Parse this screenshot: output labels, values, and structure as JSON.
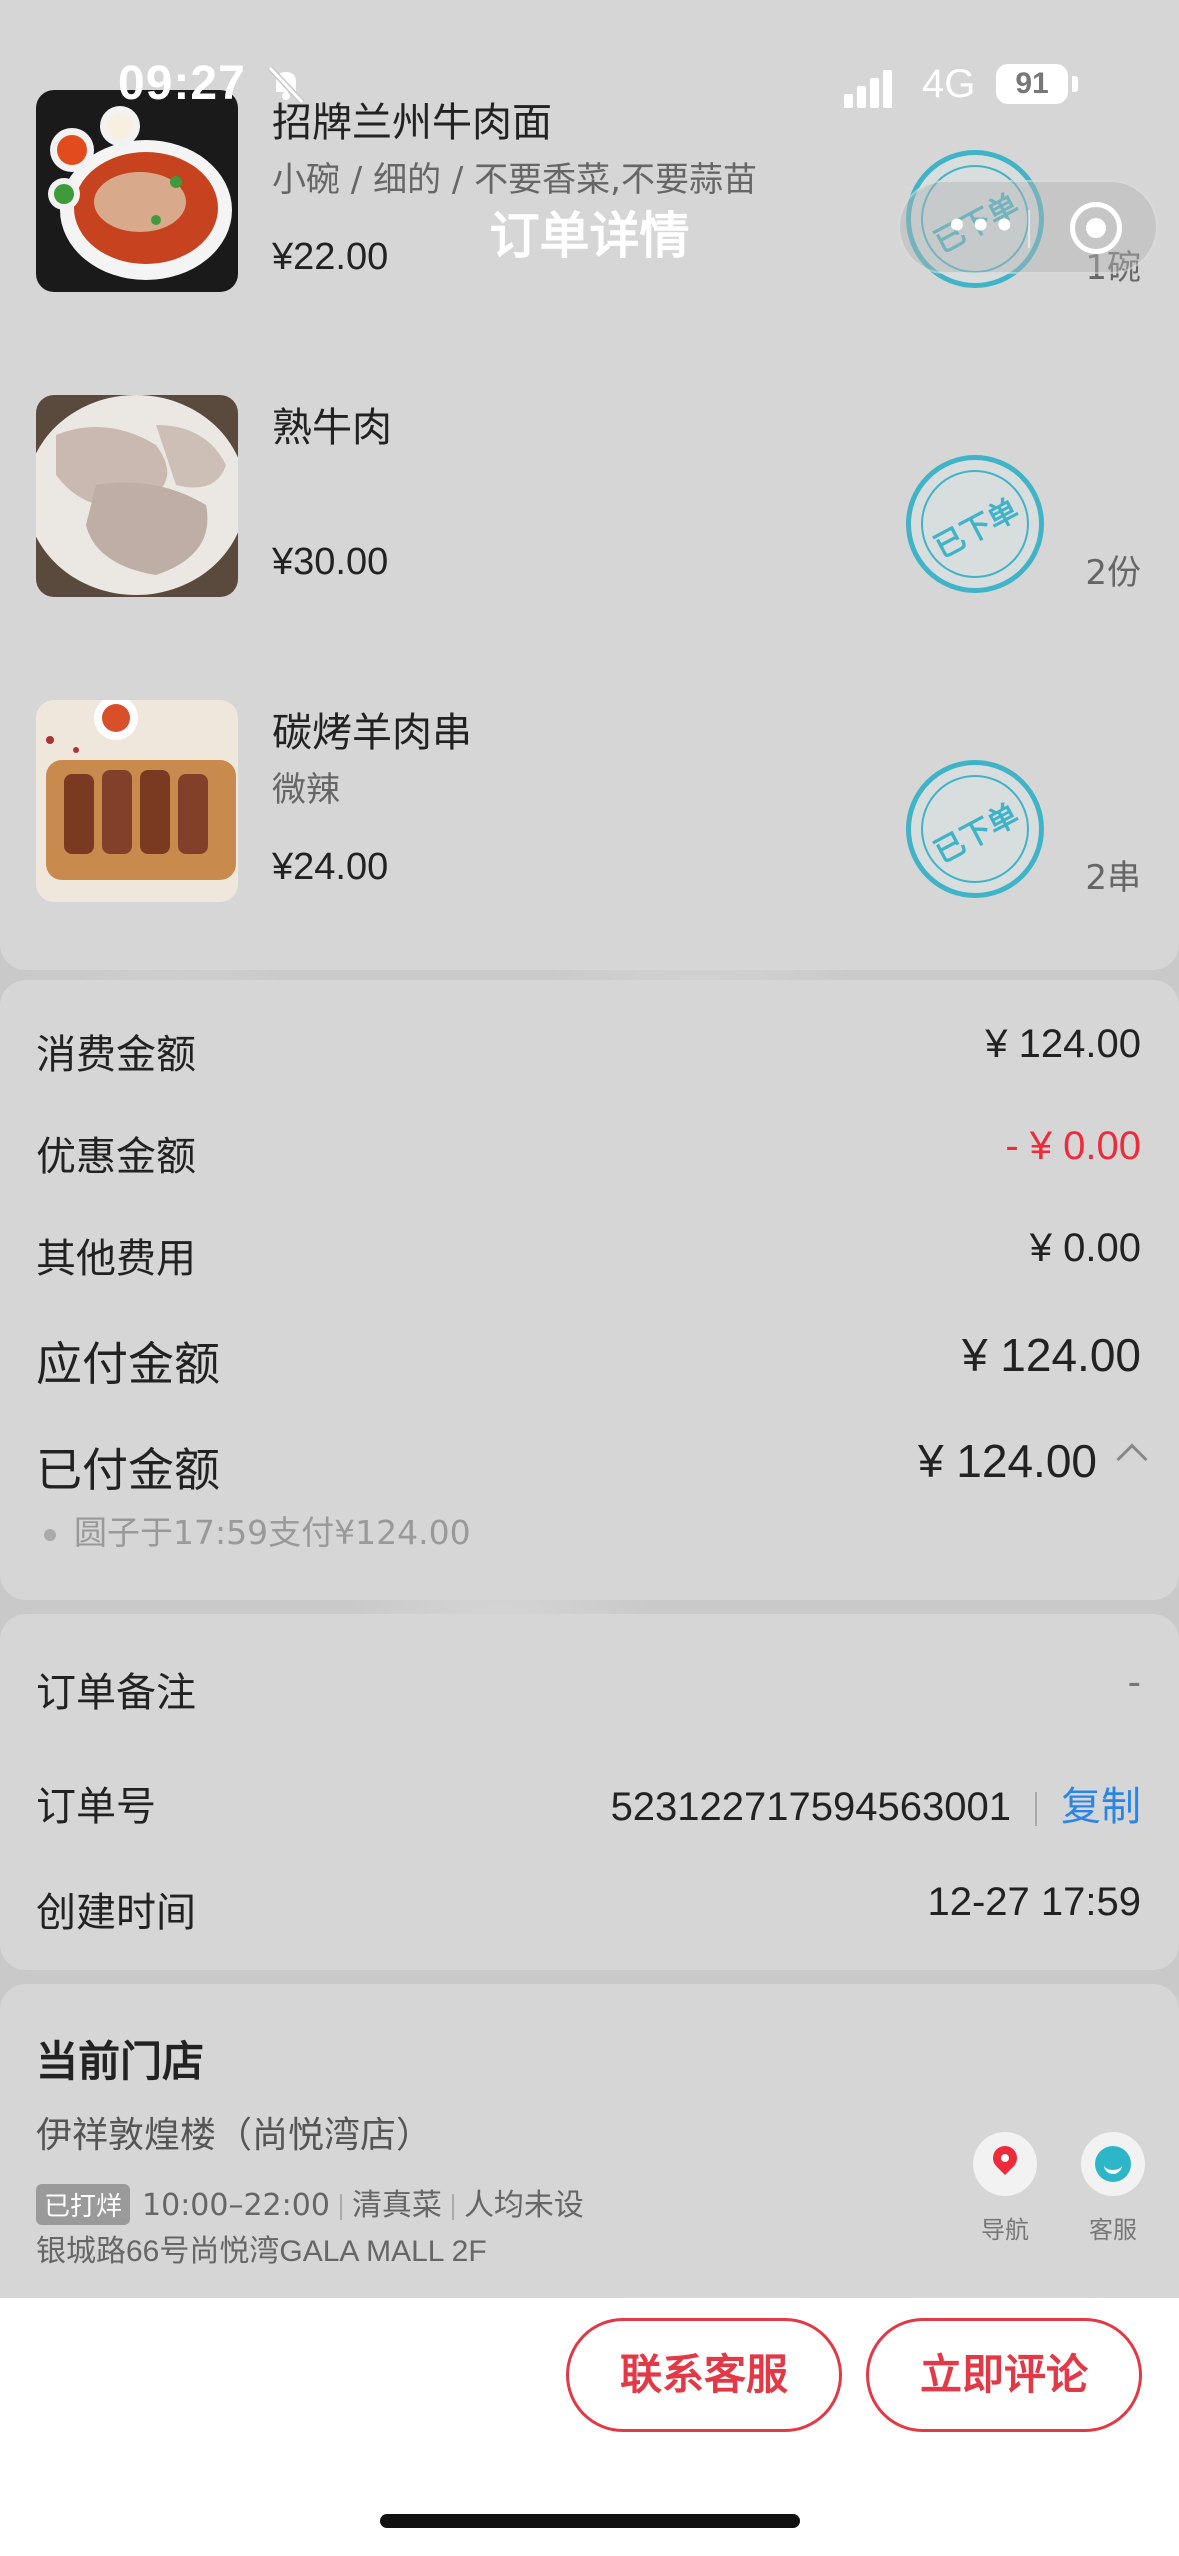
{
  "status_bar": {
    "time": "09:27",
    "network": "4G",
    "battery": "91"
  },
  "nav": {
    "title": "订单详情"
  },
  "items": [
    {
      "name": "招牌兰州牛肉面",
      "spec": "小碗 / 细的 / 不要香菜,不要蒜苗",
      "price": "¥22.00",
      "qty": "1碗",
      "stamp": "已下单"
    },
    {
      "name": "熟牛肉",
      "spec": "",
      "price": "¥30.00",
      "qty": "2份",
      "stamp": "已下单"
    },
    {
      "name": "碳烤羊肉串",
      "spec": "微辣",
      "price": "¥24.00",
      "qty": "2串",
      "stamp": "已下单"
    }
  ],
  "amounts": {
    "consume_label": "消费金额",
    "consume_value": "¥ 124.00",
    "discount_label": "优惠金额",
    "discount_value": "- ¥ 0.00",
    "other_label": "其他费用",
    "other_value": "¥ 0.00",
    "payable_label": "应付金额",
    "payable_value": "¥ 124.00",
    "paid_label": "已付金额",
    "paid_value": "¥ 124.00",
    "pay_note": "圆子于17:59支付¥124.00"
  },
  "order_info": {
    "remark_label": "订单备注",
    "remark_value": "-",
    "order_no_label": "订单号",
    "order_no_value": "523122717594563001",
    "copy_label": "复制",
    "created_label": "创建时间",
    "created_value": "12-27 17:59"
  },
  "store": {
    "section_title": "当前门店",
    "name": "伊祥敦煌楼（尚悦湾店）",
    "status_badge": "已打烊",
    "hours": "10:00–22:00",
    "category": "清真菜",
    "avg_price": "人均未设",
    "address": "银城路66号尚悦湾GALA MALL 2F",
    "nav_label": "导航",
    "service_label": "客服"
  },
  "buttons": {
    "contact": "联系客服",
    "review": "立即评论"
  },
  "colors": {
    "accent_red": "#e33845",
    "stamp_teal": "#3fb3c7",
    "link_blue": "#2a86e6"
  }
}
